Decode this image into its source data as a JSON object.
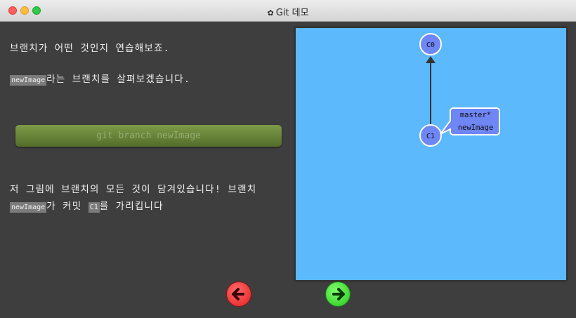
{
  "window": {
    "title": "Git 데모"
  },
  "intro": {
    "line1": "브랜치가 어떤 것인지 연습해보죠.",
    "line2_code": "newImage",
    "line2_text": "라는 브랜치를 살펴보겠습니다."
  },
  "command": {
    "label": "git branch newImage"
  },
  "result": {
    "line1": "저 그림에 브랜치의 모든 것이 담겨있습니다! 브랜치",
    "code_branch": "newImage",
    "text_a": "가 커밋 ",
    "code_commit": "C1",
    "text_b": "를 가리킵니다"
  },
  "graph": {
    "commits": [
      {
        "id": "C0"
      },
      {
        "id": "C1"
      }
    ],
    "branch_label": {
      "line1": "master*",
      "line2": "newImage"
    }
  },
  "nav": {
    "back_icon": "arrow-left-icon",
    "forward_icon": "arrow-right-icon"
  },
  "colors": {
    "canvas": "#5cb9fb",
    "commit_fill": "#6f86f5",
    "command_button": "#67823a",
    "back_button": "#e51f1f",
    "forward_button": "#27c51c"
  }
}
